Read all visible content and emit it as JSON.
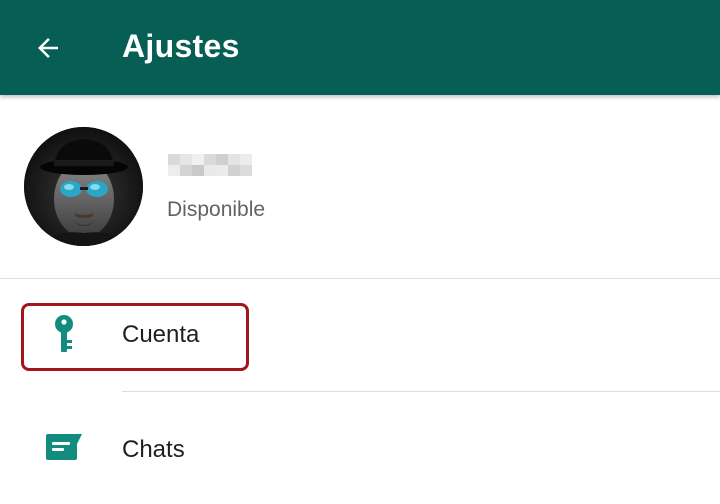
{
  "header": {
    "title": "Ajustes",
    "back_icon": "arrow-back-icon",
    "background": "#075e54"
  },
  "profile": {
    "name": "",
    "status": "Disponible",
    "avatar_icon": "profile-avatar"
  },
  "settings": {
    "items": [
      {
        "label": "Cuenta",
        "icon": "key-icon",
        "highlighted": true
      },
      {
        "label": "Chats",
        "icon": "chat-icon",
        "highlighted": false
      }
    ]
  },
  "colors": {
    "accent": "#128c7e",
    "highlight_border": "#a0151e"
  }
}
